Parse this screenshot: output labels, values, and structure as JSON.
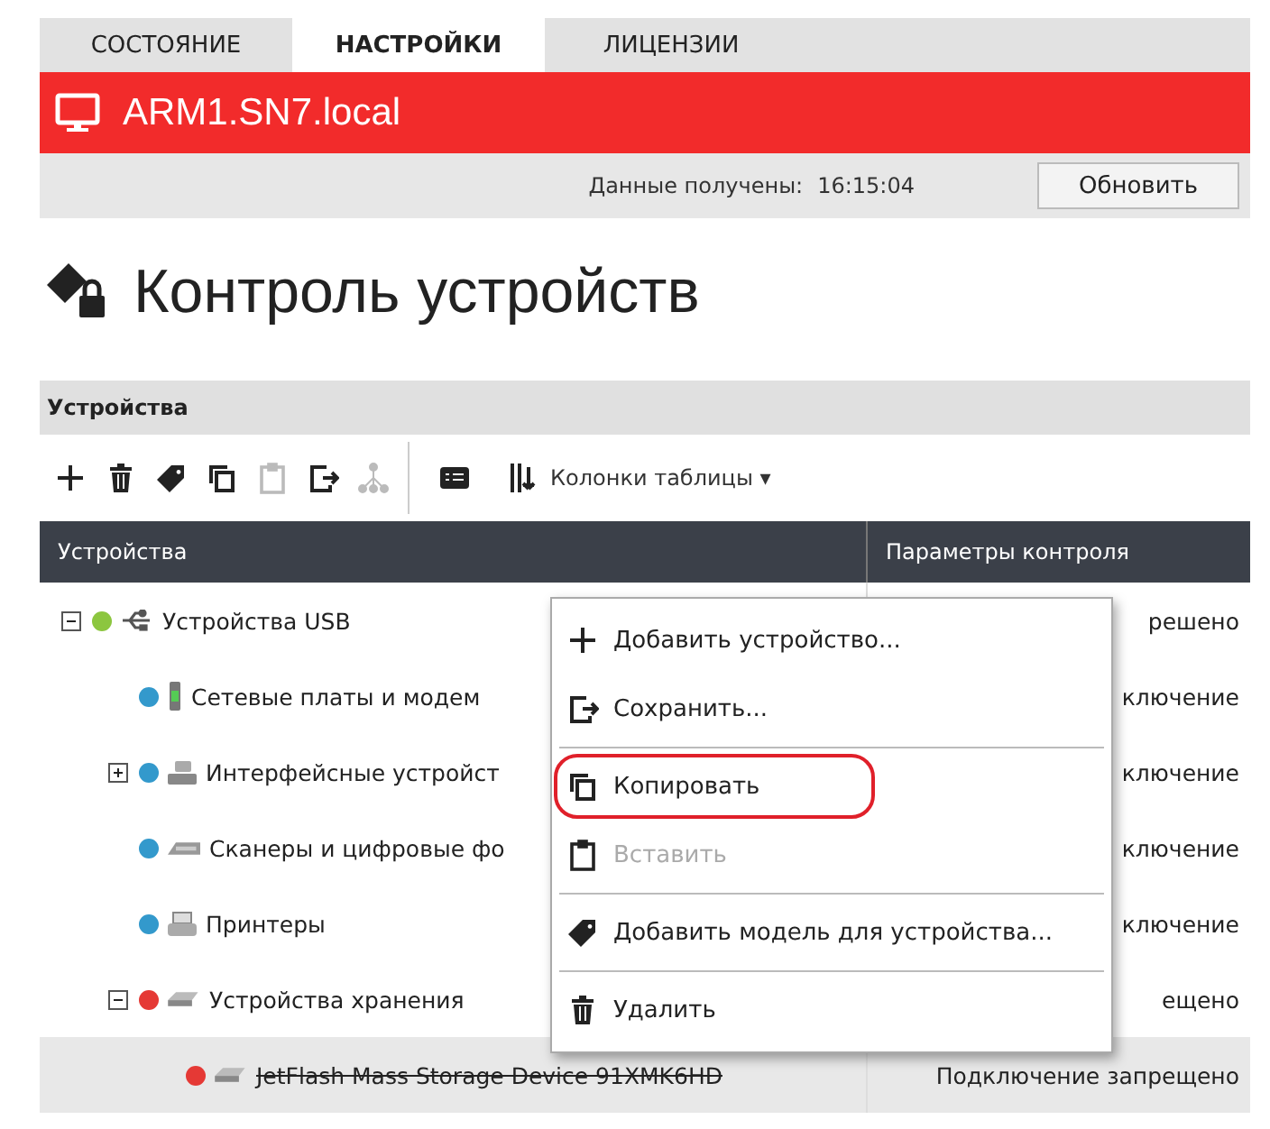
{
  "tabs": [
    {
      "label": "СОСТОЯНИЕ",
      "selected": false
    },
    {
      "label": "НАСТРОЙКИ",
      "selected": true
    },
    {
      "label": "ЛИЦЕНЗИИ",
      "selected": false
    }
  ],
  "host": {
    "name": "ARM1.SN7.local"
  },
  "status": {
    "label": "Данные получены:",
    "time": "16:15:04",
    "button": "Обновить"
  },
  "page_title": "Контроль устройств",
  "section": {
    "title": "Устройства"
  },
  "toolbar": {
    "buttons": [
      {
        "kind": "plus",
        "disabled": false
      },
      {
        "kind": "trash",
        "disabled": false
      },
      {
        "kind": "tag",
        "disabled": false
      },
      {
        "kind": "copy",
        "disabled": false
      },
      {
        "kind": "paste",
        "disabled": true
      },
      {
        "kind": "export",
        "disabled": false
      },
      {
        "kind": "tree",
        "disabled": true
      }
    ],
    "columns_menu": {
      "label": "Колонки таблицы",
      "caret": "▾"
    }
  },
  "table": {
    "columns": [
      "Устройства",
      "Параметры контроля"
    ],
    "rows": [
      {
        "name": "Устройства USB",
        "kind": "usb",
        "color": "#8cc63f",
        "expanded": true,
        "struck": false,
        "selected": false,
        "control": "решено",
        "children": [
          {
            "name": "Сетевые платы и модем",
            "kind": "phone",
            "color": "#3399cc",
            "struck": false,
            "selected": false,
            "control": "ключение"
          },
          {
            "name": "Интерфейсные устройст",
            "kind": "keyboard",
            "color": "#3399cc",
            "expanded": false,
            "struck": false,
            "selected": false,
            "control": "ключение"
          },
          {
            "name": "Сканеры и цифровые фо",
            "kind": "scanner",
            "color": "#3399cc",
            "struck": false,
            "selected": false,
            "control": "ключение"
          },
          {
            "name": "Принтеры",
            "kind": "printer",
            "color": "#3399cc",
            "struck": false,
            "selected": false,
            "control": "ключение"
          },
          {
            "name": "Устройства хранения",
            "kind": "drive",
            "color": "#e53935",
            "expanded": true,
            "struck": false,
            "selected": false,
            "control": "ещено",
            "children": [
              {
                "name": "JetFlash Mass Storage Device 91XMK6HD",
                "kind": "drive",
                "color": "#e53935",
                "struck": true,
                "selected": true,
                "control": "Подключение запрещено"
              }
            ]
          }
        ]
      }
    ]
  },
  "context_menu": {
    "groups": [
      [
        {
          "label": "Добавить устройство...",
          "kind": "plus",
          "disabled": false,
          "circled": false
        },
        {
          "label": "Сохранить...",
          "kind": "export",
          "disabled": false,
          "circled": false
        }
      ],
      [
        {
          "label": "Копировать",
          "kind": "copy",
          "disabled": false,
          "circled": true
        },
        {
          "label": "Вставить",
          "kind": "paste",
          "disabled": true,
          "circled": false
        }
      ],
      [
        {
          "label": "Добавить модель для устройства...",
          "kind": "tag",
          "disabled": false,
          "circled": false
        }
      ],
      [
        {
          "label": "Удалить",
          "kind": "trash",
          "disabled": false,
          "circled": false
        }
      ]
    ]
  }
}
